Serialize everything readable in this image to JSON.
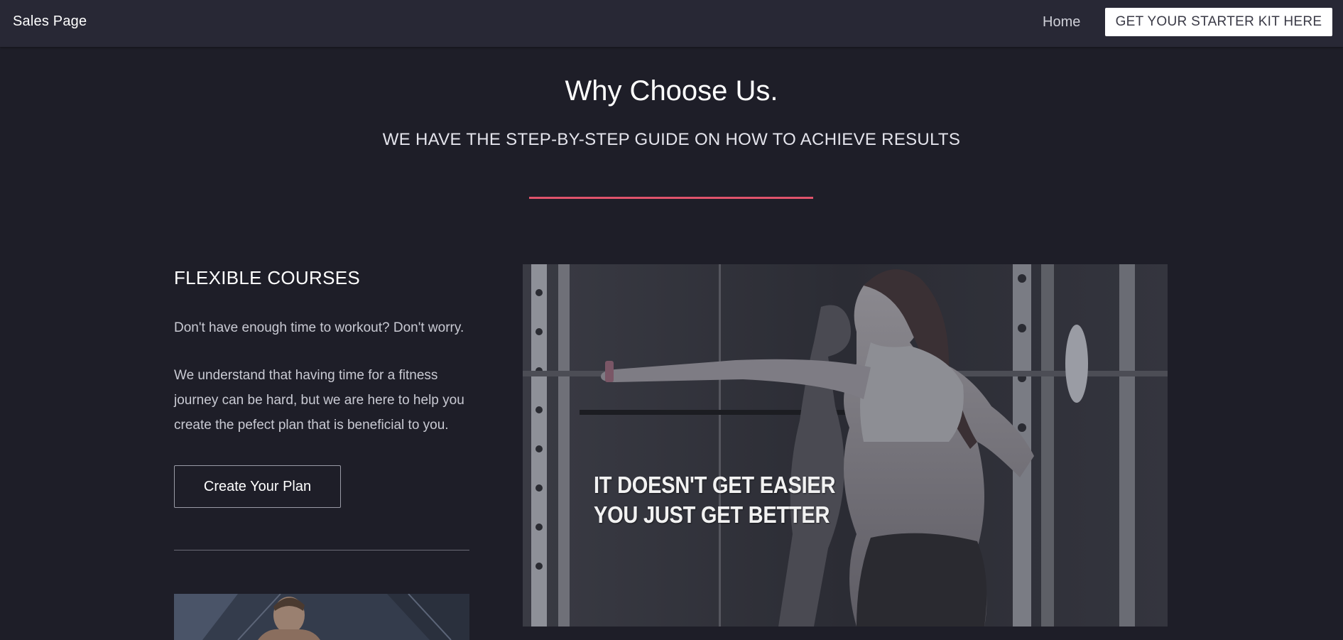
{
  "nav": {
    "brand": "Sales Page",
    "home_label": "Home",
    "cta_label": "GET YOUR STARTER KIT HERE"
  },
  "header": {
    "title": "Why Choose Us.",
    "subtitle": "WE HAVE THE STEP-BY-STEP GUIDE ON HOW TO ACHIEVE RESULTS"
  },
  "feature": {
    "heading": "FLEXIBLE COURSES",
    "paragraph_1": "Don't have enough time to workout? Don't worry.",
    "paragraph_2": "We understand that having time for a fitness journey can be hard, but we are here to help you create the pefect plan that is beneficial to you.",
    "button_label": "Create Your Plan"
  },
  "hero_image": {
    "caption_line_1": "IT DOESN'T GET EASIER",
    "caption_line_2": "YOU JUST GET BETTER"
  },
  "colors": {
    "background": "#1e1e28",
    "navbar": "#282835",
    "accent": "#e0536b",
    "cta_background": "#ffffff"
  }
}
